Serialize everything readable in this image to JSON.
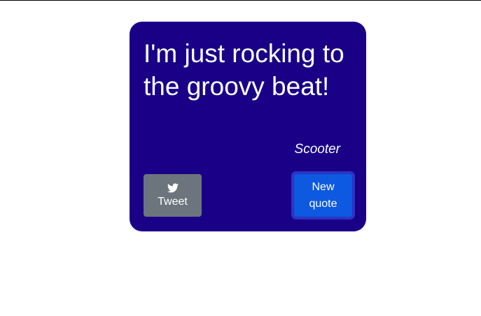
{
  "quote": {
    "text": "I'm just rocking to the groovy beat!",
    "author": "Scooter"
  },
  "buttons": {
    "tweet_label": "Tweet",
    "tweet_icon": "twitter-icon",
    "new_quote_label": "New quote"
  },
  "colors": {
    "card_background": "#190087",
    "tweet_button": "#6c757d",
    "new_quote_button": "#0d59e0",
    "focus_ring": "#2b34c6",
    "text": "#ffffff"
  }
}
